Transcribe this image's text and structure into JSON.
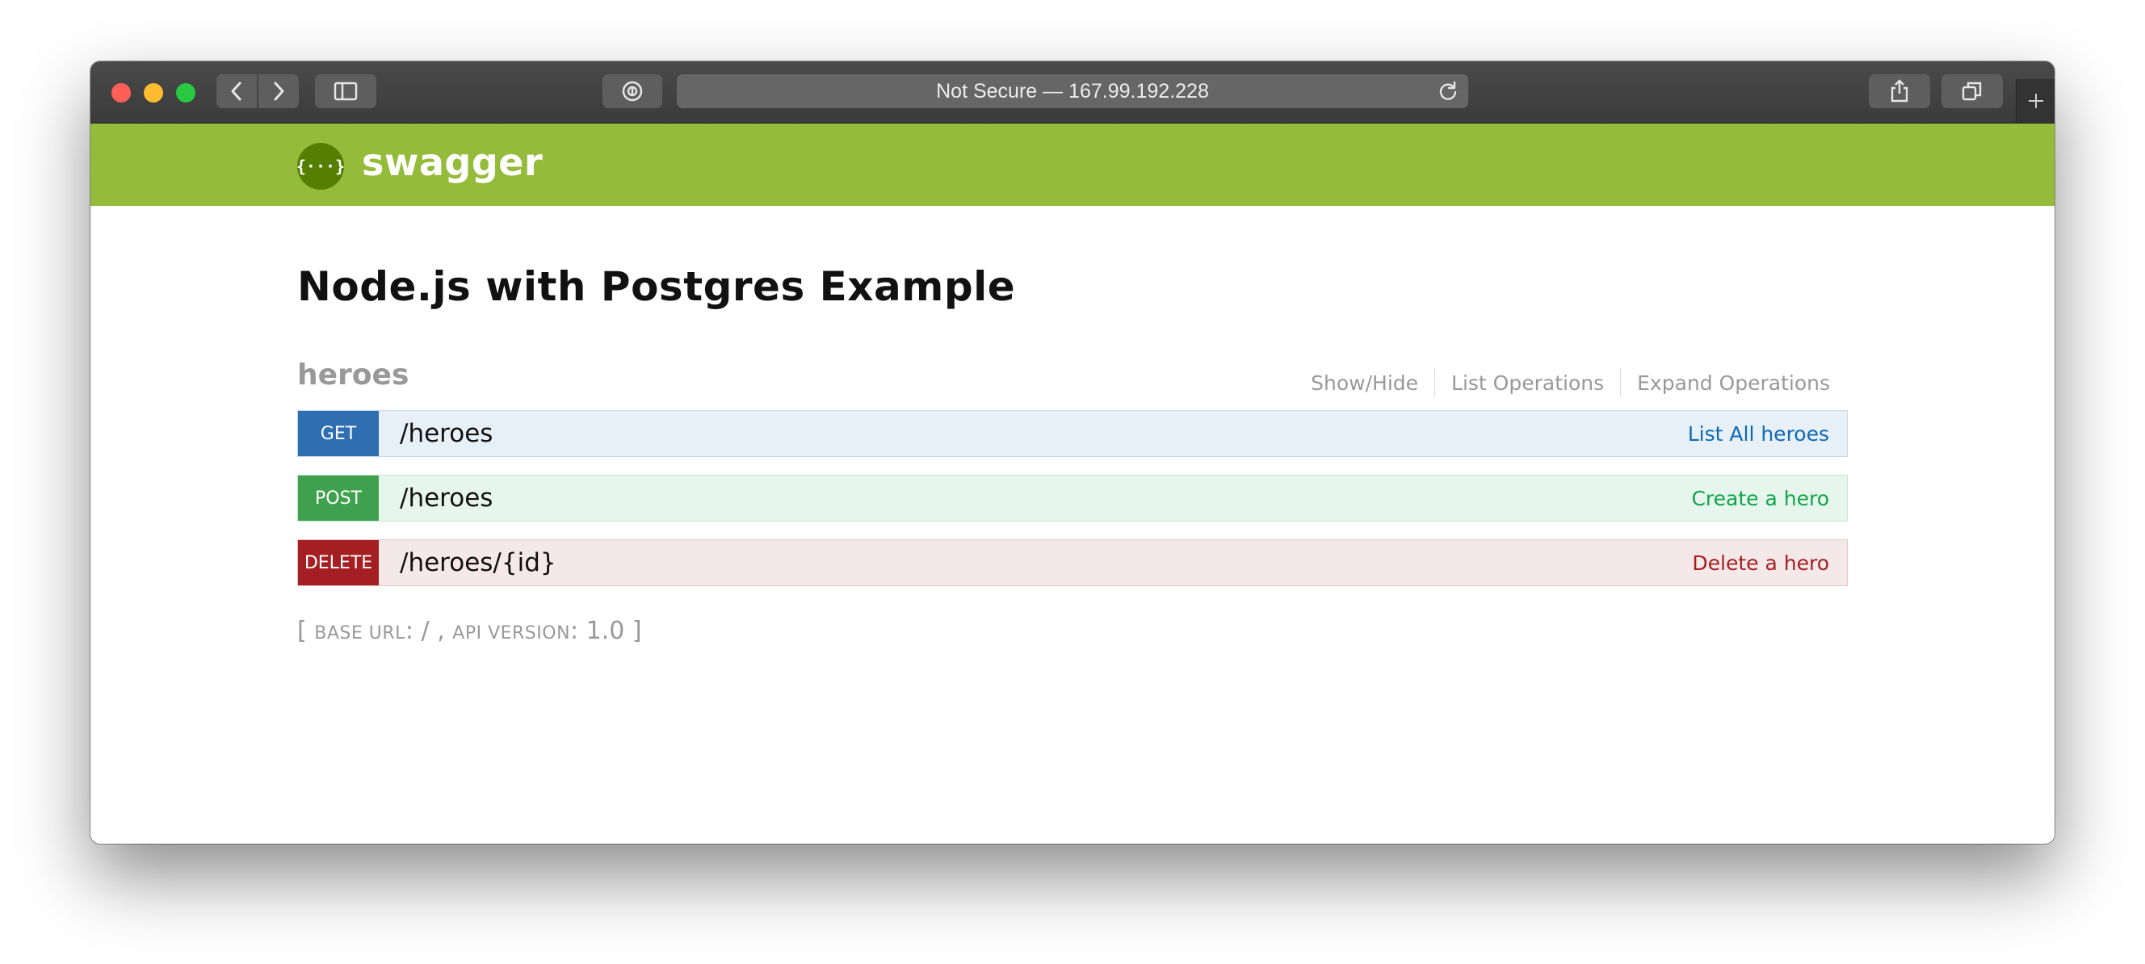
{
  "browser": {
    "address": "Not Secure — 167.99.192.228"
  },
  "header": {
    "logo_glyph": "{···}",
    "title": "swagger"
  },
  "api": {
    "title": "Node.js with Postgres Example"
  },
  "resource": {
    "name": "heroes",
    "actions": [
      "Show/Hide",
      "List Operations",
      "Expand Operations"
    ]
  },
  "operations": [
    {
      "method": "GET",
      "path": "/heroes",
      "summary": "List All heroes",
      "color": "#0f6ab4"
    },
    {
      "method": "POST",
      "path": "/heroes",
      "summary": "Create a hero",
      "color": "#10a54a"
    },
    {
      "method": "DELETE",
      "path": "/heroes/{id}",
      "summary": "Delete a hero",
      "color": "#a41e22"
    }
  ],
  "footer": {
    "open": "[ ",
    "base_url_label": "base url",
    "base_url_value": ": / , ",
    "api_version_label": "api version",
    "api_version_value": ": 1.0 ]"
  },
  "icons": [
    "close-light",
    "minimize-light",
    "maximize-light",
    "back-icon",
    "forward-icon",
    "sidebar-icon",
    "privacy-icon",
    "reload-icon",
    "share-icon",
    "tabs-icon",
    "plus-icon"
  ],
  "colors": {
    "header_bg": "#94bb3a",
    "get": "#2f6fb1",
    "post": "#3fa14d",
    "delete": "#a41e22"
  }
}
